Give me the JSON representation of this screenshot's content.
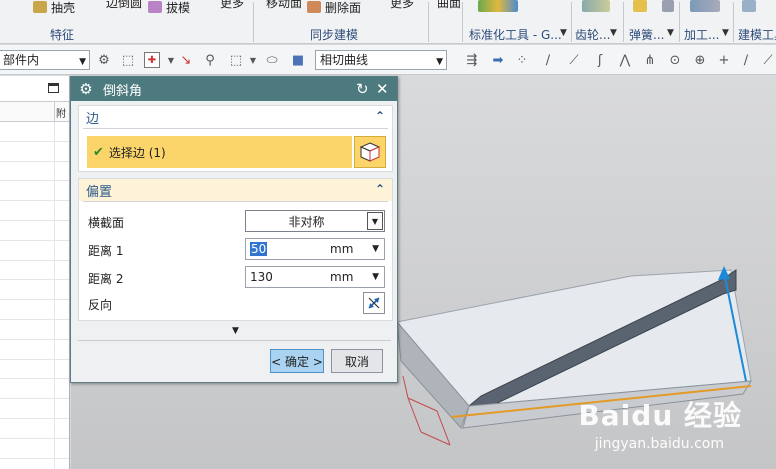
{
  "ribbon": {
    "items": [
      {
        "label": "抽壳"
      },
      {
        "label": "拔模"
      },
      {
        "label": "删除面"
      }
    ],
    "cut_labels": [
      "边倒圆",
      "更多",
      "移动面",
      "更多",
      "曲面"
    ],
    "groups": [
      {
        "label": "特征"
      },
      {
        "label": "同步建模"
      },
      {
        "label": "标准化工具 - G..."
      },
      {
        "label": "齿轮..."
      },
      {
        "label": "弹簧..."
      },
      {
        "label": "加工..."
      },
      {
        "label": "建模工具"
      }
    ]
  },
  "toolbar": {
    "scope_combo": "部件内",
    "curve_rule_combo": "相切曲线"
  },
  "navigator": {
    "column_header": "附"
  },
  "dialog": {
    "title": "倒斜角",
    "edge_section": {
      "title": "边",
      "select_label": "选择边 (1)"
    },
    "offset_section": {
      "title": "偏置",
      "cross_section_label": "横截面",
      "cross_section_value": "非对称",
      "distance1_label": "距离 1",
      "distance1_value": "50",
      "distance1_unit": "mm",
      "distance2_label": "距离 2",
      "distance2_value": "130",
      "distance2_unit": "mm",
      "reverse_label": "反向"
    },
    "ok_label": "< 确定 >",
    "cancel_label": "取消"
  },
  "watermark": {
    "brand": "Baidu 经验",
    "url": "jingyan.baidu.com"
  },
  "colors": {
    "title_bar": "#4d7a7e",
    "selection_highlight": "#fbd56a",
    "section_title": "#2e5a8a",
    "ok_button": "#a9d3f1",
    "solid_top": "#e6e9ee",
    "chamfer_face": "#5a6470"
  }
}
